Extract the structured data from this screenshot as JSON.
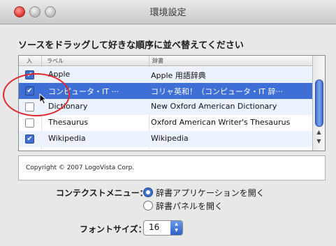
{
  "window": {
    "title": "環境設定"
  },
  "instruction": "ソースをドラッグして好きな順序に並べ替えてください",
  "table": {
    "headers": [
      "入",
      "ラベル",
      "辞書"
    ],
    "rows": [
      {
        "checked": true,
        "label": "Apple",
        "dictionary": "Apple 用語辞典"
      },
      {
        "checked": true,
        "label": "コンピュータ・IT ···",
        "dictionary": "コリャ英和！（コンピュータ・IT 辞···"
      },
      {
        "checked": false,
        "label": "Dictionary",
        "dictionary": "New Oxford American Dictionary"
      },
      {
        "checked": false,
        "label": "Thesaurus",
        "dictionary": "Oxford American Writer's Thesaurus"
      },
      {
        "checked": true,
        "label": "Wikipedia",
        "dictionary": "Wikipedia"
      }
    ]
  },
  "copyright": "Copyright © 2007 LogoVista Corp.",
  "context_menu": {
    "label": "コンテクストメニュー：",
    "options": [
      {
        "label": "辞書アプリケーションを開く",
        "selected": true
      },
      {
        "label": "辞書パネルを開く",
        "selected": false
      }
    ]
  },
  "font_size": {
    "label": "フォントサイズ：",
    "value": "16"
  },
  "colors": {
    "selection": "#3d6fd6",
    "callout": "#e0282b"
  }
}
